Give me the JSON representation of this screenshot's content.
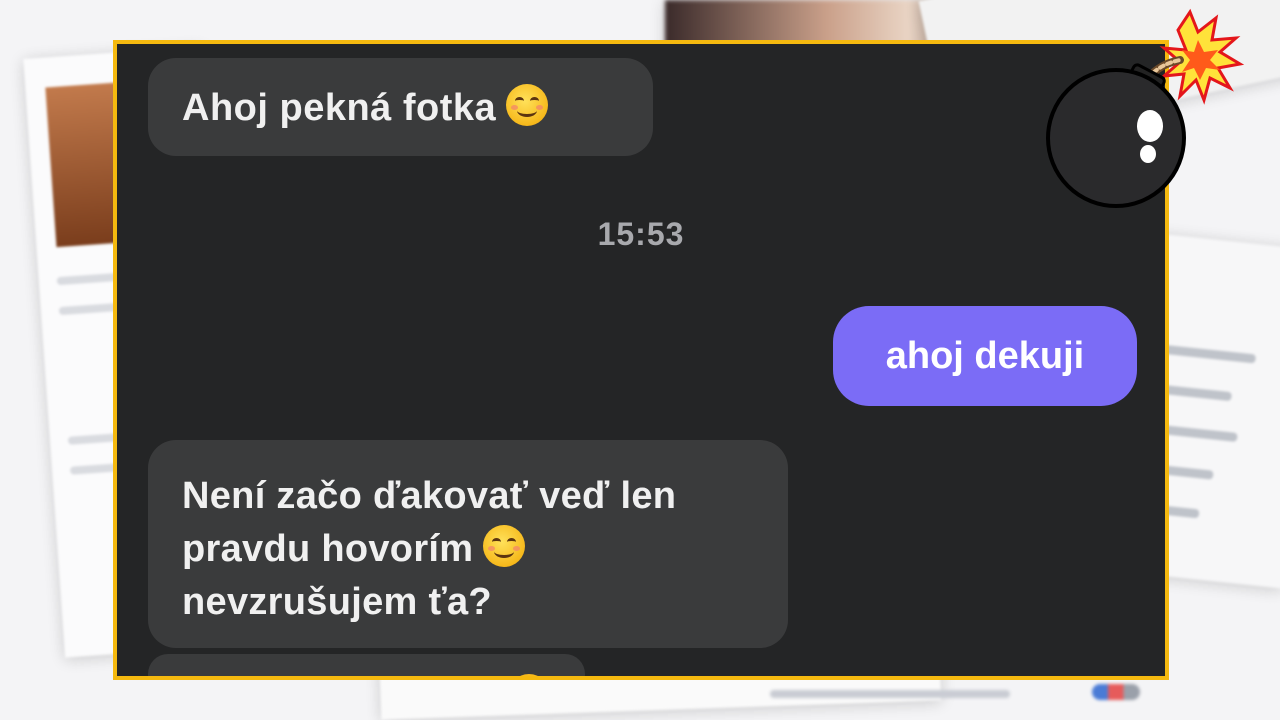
{
  "conversation": {
    "messages": [
      {
        "direction": "incoming",
        "text": "Ahoj pekná fotka",
        "emoji": "smiling-face-icon"
      },
      {
        "direction": "outgoing",
        "text": "ahoj dekuji"
      },
      {
        "direction": "incoming",
        "lines": [
          "Není začo ďakovať veď len",
          "pravdu hovorím",
          "nevzrušujem ťa?"
        ],
        "emoji": "smiling-face-icon"
      }
    ],
    "timestamp": "15:53"
  },
  "colors": {
    "frame_border": "#f5b90f",
    "chat_background": "#242526",
    "incoming_bubble": "#3a3b3c",
    "outgoing_bubble": "#7b6cf6"
  },
  "decorations": {
    "sticker": "bomb-icon"
  }
}
